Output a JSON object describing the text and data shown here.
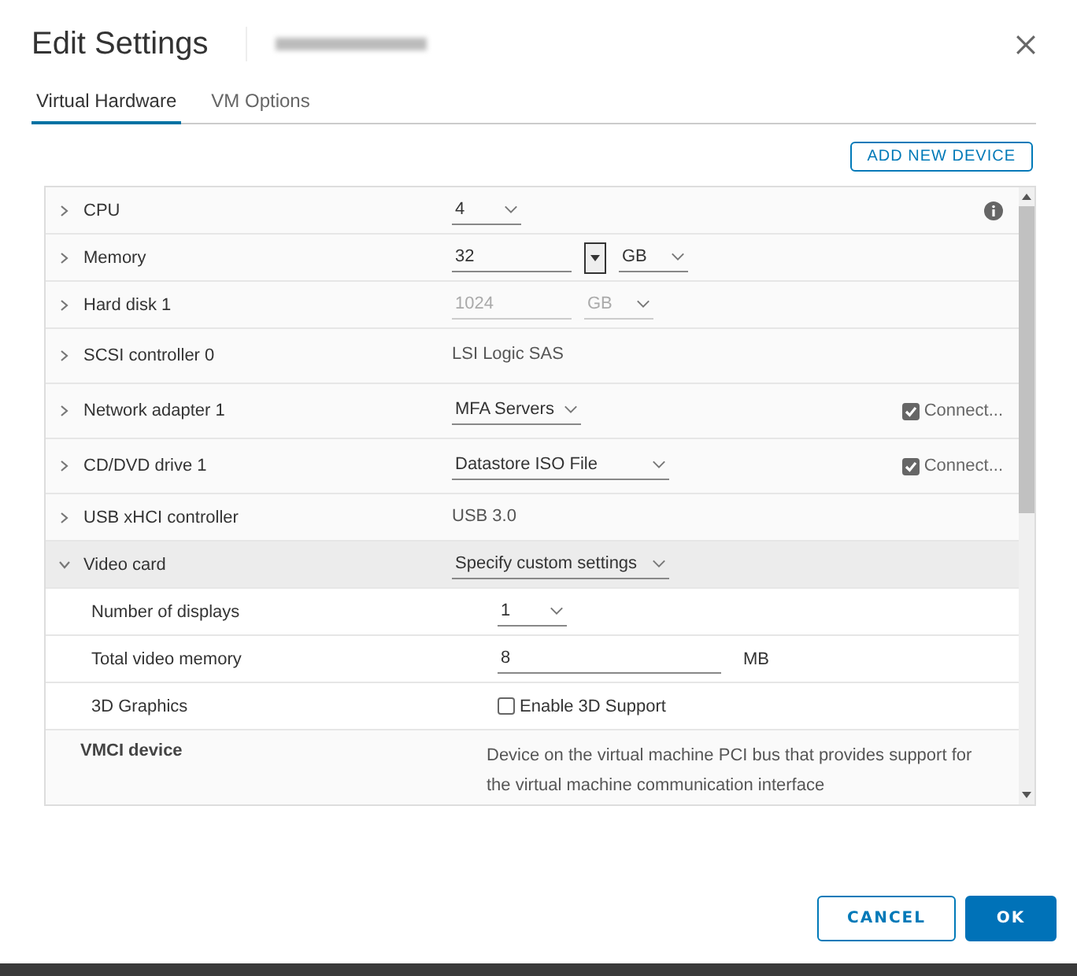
{
  "dialog": {
    "title": "Edit Settings"
  },
  "tabs": [
    {
      "label": "Virtual Hardware",
      "selected": true
    },
    {
      "label": "VM Options",
      "selected": false
    }
  ],
  "add_button": "ADD NEW DEVICE",
  "rows": [
    {
      "label": "CPU",
      "expanded": false,
      "kind": "select",
      "value": "4",
      "info": true
    },
    {
      "label": "Memory",
      "expanded": false,
      "kind": "size",
      "value": "32",
      "unit": "GB",
      "disabled": false
    },
    {
      "label": "Hard disk 1",
      "expanded": false,
      "kind": "size",
      "value": "1024",
      "unit": "GB",
      "disabled": true
    },
    {
      "label": "SCSI controller 0",
      "expanded": false,
      "kind": "text",
      "value": "LSI Logic SAS"
    },
    {
      "label": "Network adapter 1",
      "expanded": false,
      "kind": "select",
      "value": "MFA Servers",
      "connect": {
        "label": "Connect...",
        "checked": true
      }
    },
    {
      "label": "CD/DVD drive 1",
      "expanded": false,
      "kind": "select",
      "wide": true,
      "value": "Datastore ISO File",
      "connect": {
        "label": "Connect...",
        "checked": true
      }
    },
    {
      "label": "USB xHCI controller",
      "expanded": false,
      "kind": "text",
      "value": "USB 3.0"
    },
    {
      "label": "Video card",
      "expanded": true,
      "kind": "select",
      "wide": true,
      "value": "Specify custom settings",
      "children": [
        {
          "label": "Number of displays",
          "kind": "select",
          "value": "1"
        },
        {
          "label": "Total video memory",
          "kind": "input",
          "value": "8",
          "suffix": "MB"
        },
        {
          "label": "3D Graphics",
          "kind": "checkbox",
          "value": "Enable 3D Support",
          "checked": false
        }
      ]
    },
    {
      "label": "VMCI device",
      "kind": "text",
      "value": "Device on the virtual machine PCI bus that provides support for the virtual machine communication interface"
    }
  ],
  "buttons": [
    {
      "label": "CANCEL",
      "kind": "secondary"
    },
    {
      "label": "OK",
      "kind": "primary"
    }
  ]
}
